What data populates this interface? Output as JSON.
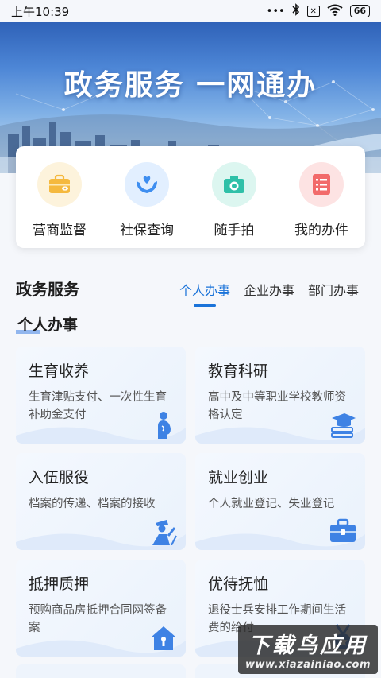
{
  "status_bar": {
    "time": "上午10:39",
    "dots": "•••",
    "battery": "66"
  },
  "hero": {
    "title": "政务服务 一网通办"
  },
  "quick_actions": [
    {
      "label": "营商监督",
      "icon": "briefcase-eye-icon",
      "color": "#f5b93e",
      "bg": "#fdf3dc"
    },
    {
      "label": "社保查询",
      "icon": "hands-heart-icon",
      "color": "#3e8ef0",
      "bg": "#e2efff"
    },
    {
      "label": "随手拍",
      "icon": "camera-icon",
      "color": "#2fc0a8",
      "bg": "#dcf6f0"
    },
    {
      "label": "我的办件",
      "icon": "document-list-icon",
      "color": "#f26a6a",
      "bg": "#fde3e3"
    }
  ],
  "services": {
    "title": "政务服务",
    "tabs": [
      {
        "label": "个人办事",
        "active": true
      },
      {
        "label": "企业办事",
        "active": false
      },
      {
        "label": "部门办事",
        "active": false
      }
    ],
    "subtitle": "个人办事",
    "cards": [
      {
        "name": "生育收养",
        "desc": "生育津贴支付、一次性生育补助金支付",
        "icon": "pregnant-person-icon"
      },
      {
        "name": "教育科研",
        "desc": "高中及中等职业学校教师资格认定",
        "icon": "graduation-cap-books-icon"
      },
      {
        "name": "入伍服役",
        "desc": "档案的传递、档案的接收",
        "icon": "soldier-salute-icon"
      },
      {
        "name": "就业创业",
        "desc": "个人就业登记、失业登记",
        "icon": "briefcase-icon"
      },
      {
        "name": "抵押质押",
        "desc": "预购商品房抵押合同网签备案",
        "icon": "house-icon"
      },
      {
        "name": "优待抚恤",
        "desc": "退役士兵安排工作期间生活费的给付",
        "icon": "medal-icon"
      }
    ]
  },
  "watermark": {
    "main": "下载鸟应用",
    "url": "www.xiazainiao.com"
  },
  "colors": {
    "accent": "#1a73d9",
    "card_bg": "#eef4fc"
  }
}
